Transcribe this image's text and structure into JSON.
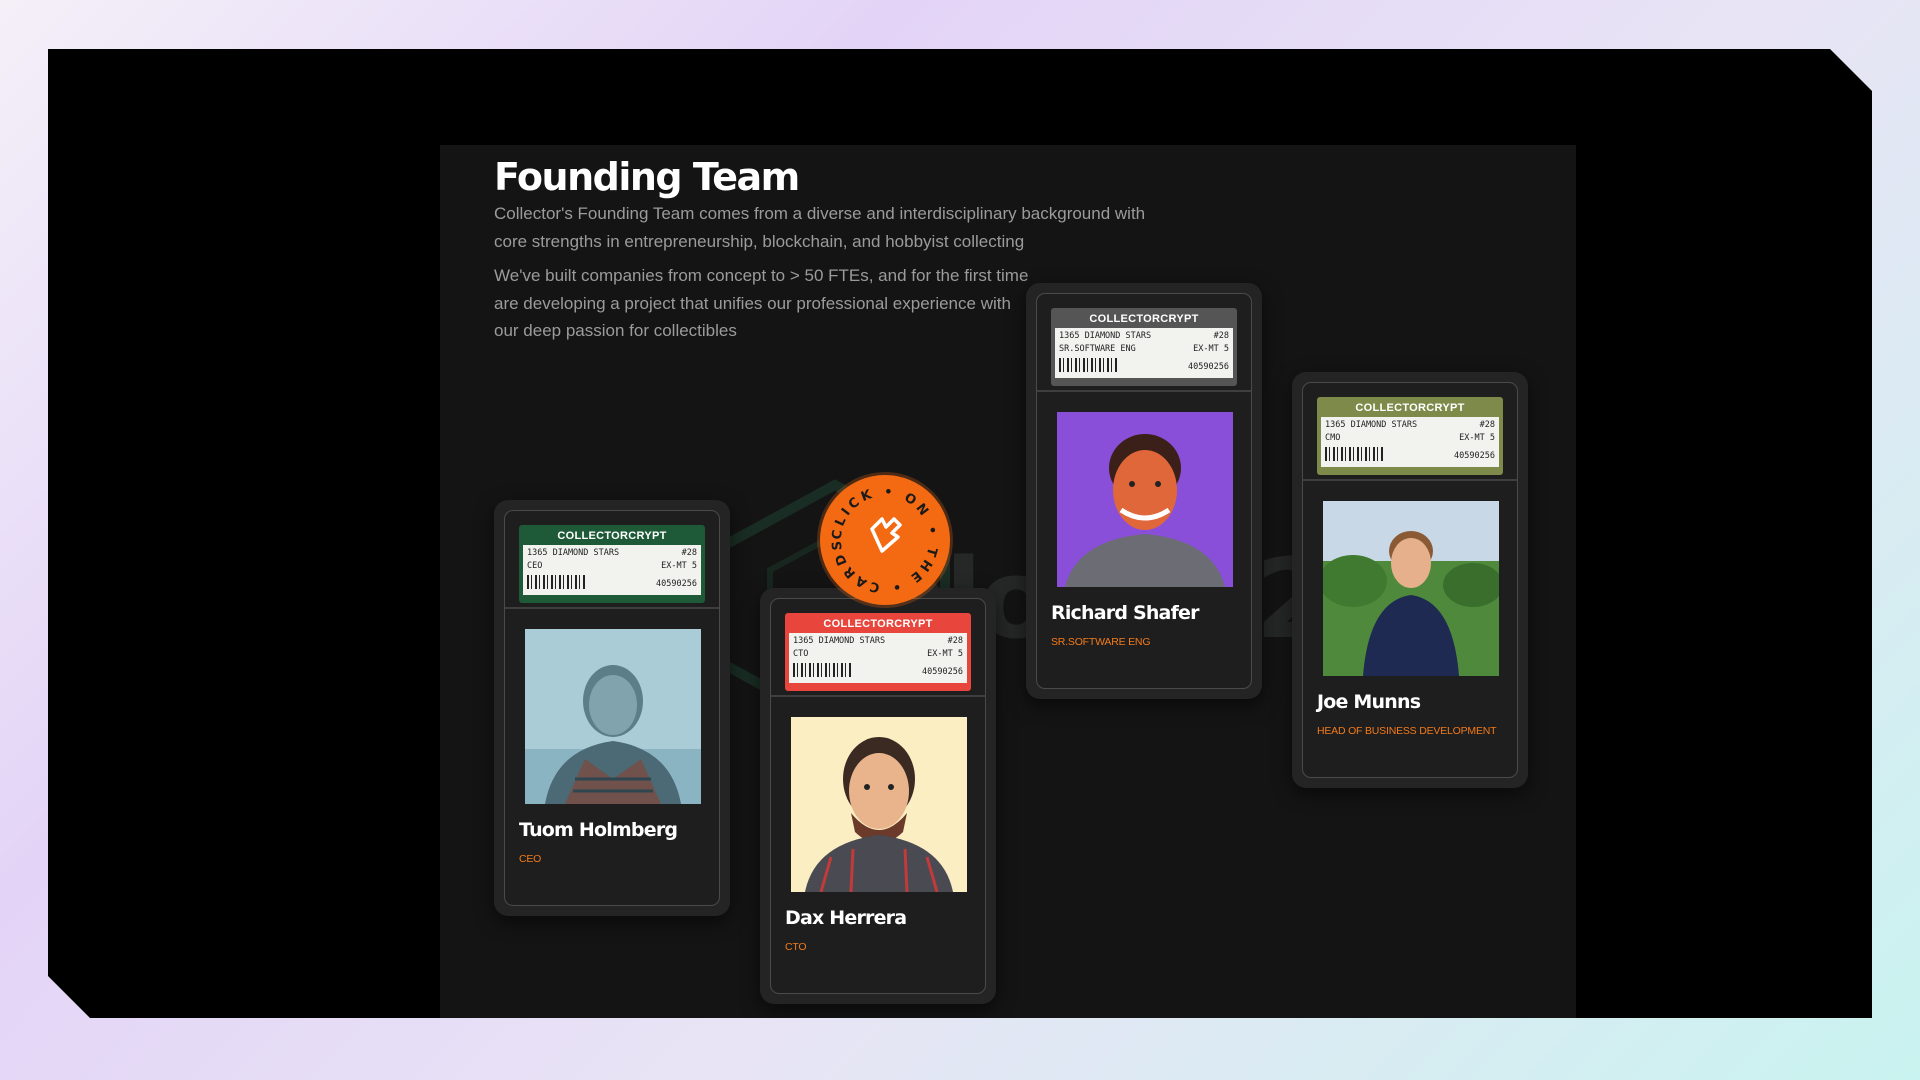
{
  "section": {
    "title": "Founding Team",
    "paragraph1": "Collector's Founding Team comes from a diverse and interdisciplinary background with core strengths in entrepreneurship, blockchain, and hobbyist collecting",
    "paragraph2": "We've built companies from concept to > 50 FTEs, and for the first time are developing a project that unifies our professional experience with our deep passion for collectibles"
  },
  "badge": {
    "text": "CLICK • ON • THE • CARDS • ",
    "color": "#f36a12"
  },
  "watermark": "blockd2",
  "cards": [
    {
      "brand": "COLLECTORCRYPT",
      "label_line1_left": "1365 DIAMOND STARS",
      "label_line1_right": "#28",
      "label_line2_left": "CEO",
      "label_line2_right": "EX-MT 5",
      "cert": "40590256",
      "label_color": "#1f5a38",
      "name": "Tuom Holmberg",
      "role": "CEO"
    },
    {
      "brand": "COLLECTORCRYPT",
      "label_line1_left": "1365 DIAMOND STARS",
      "label_line1_right": "#28",
      "label_line2_left": "CTO",
      "label_line2_right": "EX-MT 5",
      "cert": "40590256",
      "label_color": "#e8463c",
      "name": "Dax Herrera",
      "role": "CTO"
    },
    {
      "brand": "COLLECTORCRYPT",
      "label_line1_left": "1365 DIAMOND STARS",
      "label_line1_right": "#28",
      "label_line2_left": "SR.SOFTWARE ENG",
      "label_line2_right": "EX-MT 5",
      "cert": "40590256",
      "label_color": "#555555",
      "name": "Richard Shafer",
      "role": "SR.SOFTWARE ENG"
    },
    {
      "brand": "COLLECTORCRYPT",
      "label_line1_left": "1365 DIAMOND STARS",
      "label_line1_right": "#28",
      "label_line2_left": "CMO",
      "label_line2_right": "EX-MT 5",
      "cert": "40590256",
      "label_color": "#7e8a4a",
      "name": "Joe Munns",
      "role": "HEAD OF BUSINESS DEVELOPMENT"
    }
  ]
}
